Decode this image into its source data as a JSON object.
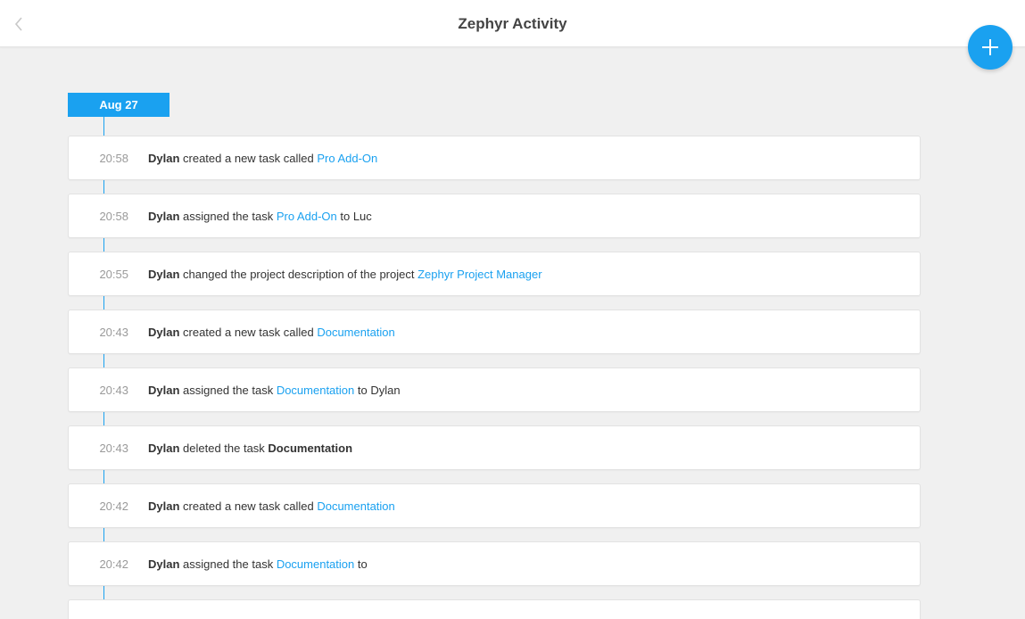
{
  "header": {
    "title": "Zephyr Activity",
    "back_icon": "chevron-left-icon",
    "add_icon": "plus-icon"
  },
  "colors": {
    "accent": "#1aa1f0",
    "background": "#f0f0f0",
    "card": "#ffffff",
    "time_text": "#9a9a9a"
  },
  "timeline": {
    "date": "Aug 27",
    "entries": [
      {
        "time": "20:58",
        "user": "Dylan",
        "text": " created a new task called ",
        "link": "Pro Add-On",
        "suffix": ""
      },
      {
        "time": "20:58",
        "user": "Dylan",
        "text": " assigned the task ",
        "link": "Pro Add-On",
        "suffix": " to Luc"
      },
      {
        "time": "20:55",
        "user": "Dylan",
        "text": " changed the project description of the project ",
        "link": "Zephyr Project Manager",
        "suffix": ""
      },
      {
        "time": "20:43",
        "user": "Dylan",
        "text": " created a new task called ",
        "link": "Documentation",
        "suffix": ""
      },
      {
        "time": "20:43",
        "user": "Dylan",
        "text": " assigned the task ",
        "link": "Documentation",
        "suffix": " to Dylan"
      },
      {
        "time": "20:43",
        "user": "Dylan",
        "text": " deleted the task ",
        "bold": "Documentation",
        "suffix": ""
      },
      {
        "time": "20:42",
        "user": "Dylan",
        "text": " created a new task called ",
        "link": "Documentation",
        "suffix": ""
      },
      {
        "time": "20:42",
        "user": "Dylan",
        "text": " assigned the task ",
        "link": "Documentation",
        "suffix": " to"
      }
    ]
  }
}
